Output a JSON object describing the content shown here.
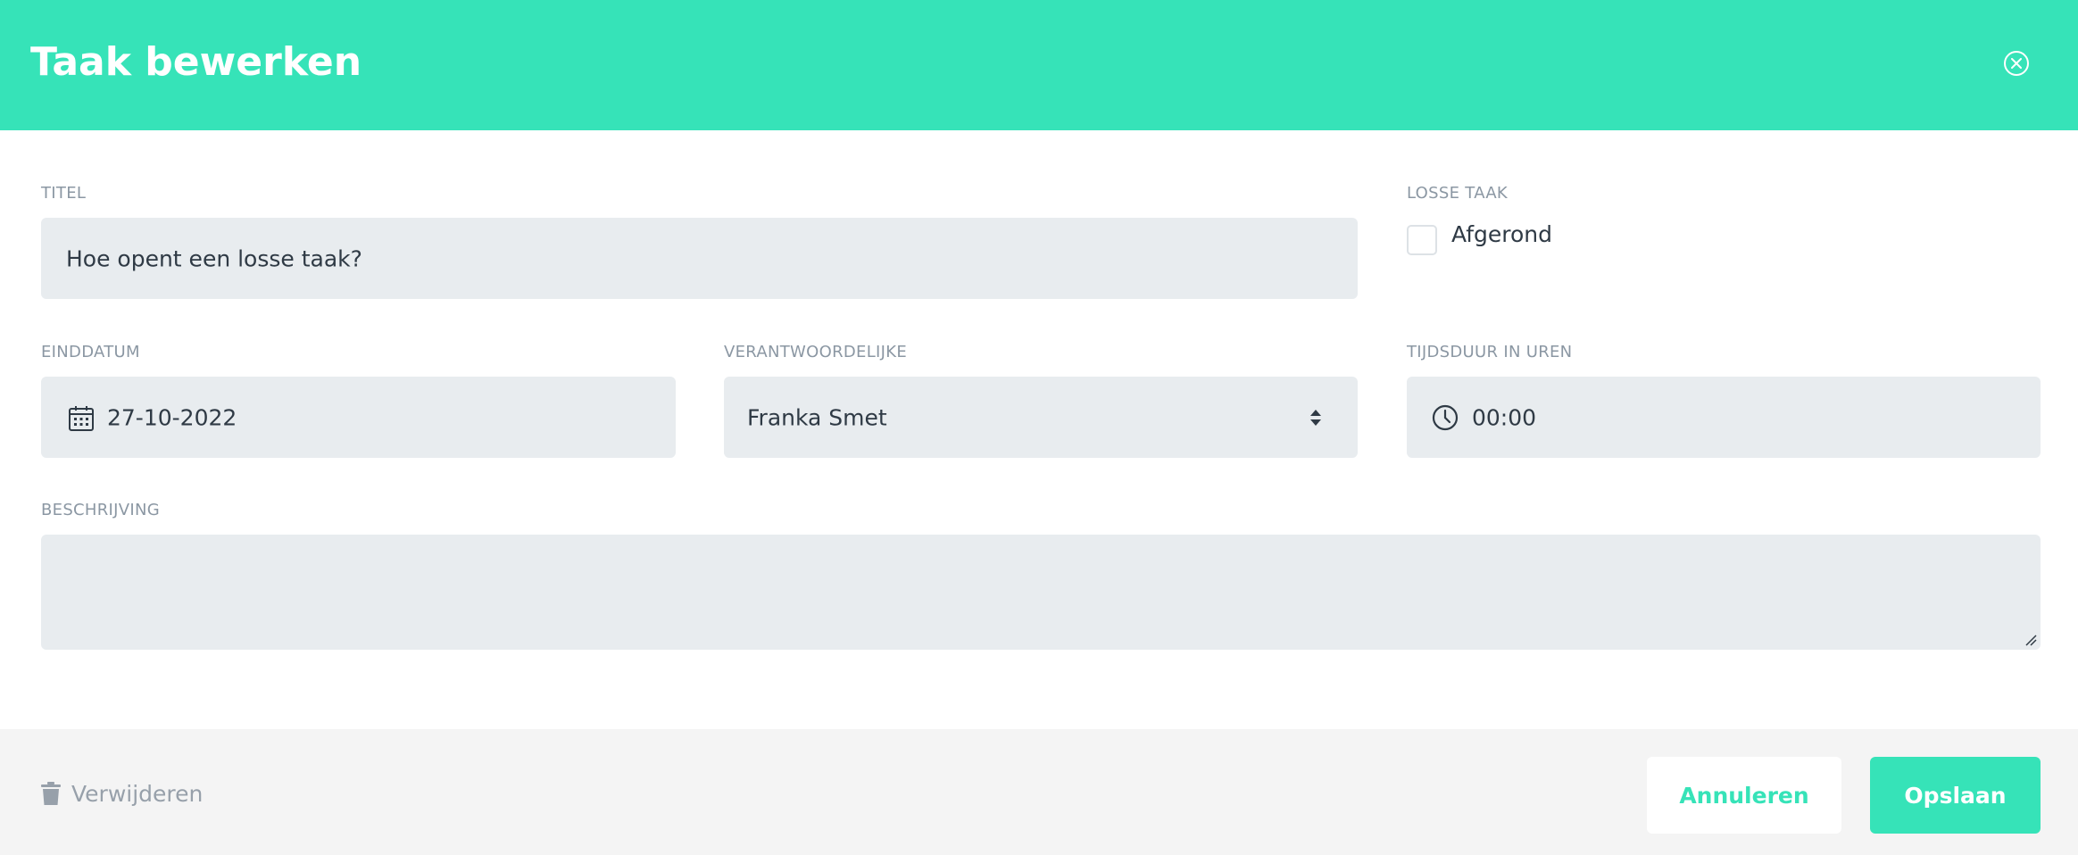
{
  "header": {
    "title": "Taak bewerken",
    "close_icon": "close-circle-icon"
  },
  "form": {
    "titel": {
      "label": "TITEL",
      "value": "Hoe opent een losse taak?"
    },
    "losse_taak": {
      "label": "LOSSE TAAK",
      "checkbox_label": "Afgerond",
      "checked": false
    },
    "einddatum": {
      "label": "EINDDATUM",
      "value": "27-10-2022",
      "icon": "calendar-icon"
    },
    "verantwoordelijke": {
      "label": "VERANTWOORDELIJKE",
      "value": "Franka Smet",
      "icon": "select-arrows-icon"
    },
    "tijdsduur": {
      "label": "TIJDSDUUR IN UREN",
      "value": "00:00",
      "icon": "clock-icon"
    },
    "beschrijving": {
      "label": "BESCHRIJVING",
      "value": ""
    }
  },
  "footer": {
    "delete_label": "Verwijderen",
    "delete_icon": "trash-icon",
    "cancel_label": "Annuleren",
    "save_label": "Opslaan"
  },
  "colors": {
    "accent": "#36e3b8",
    "field_bg": "#e8ecef",
    "label": "#8b97a3",
    "text": "#2f3a45",
    "footer_bg": "#f4f4f4"
  }
}
